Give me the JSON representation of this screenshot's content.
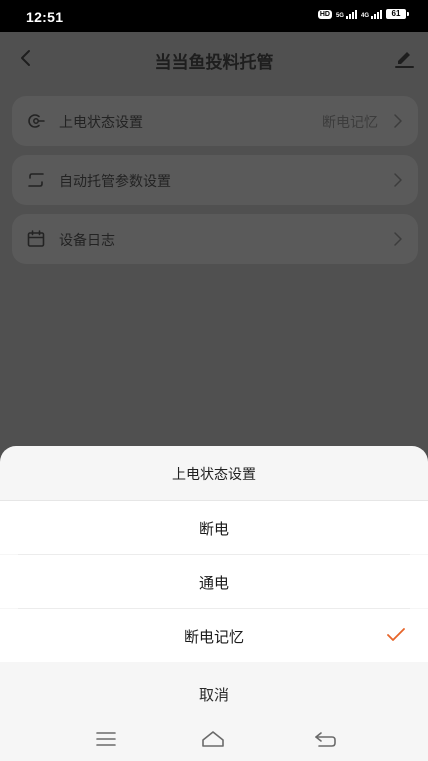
{
  "status_bar": {
    "time": "12:51",
    "hd_badge": "HD",
    "signal_1_label": "5G",
    "signal_2_label": "4G",
    "battery": "61"
  },
  "header": {
    "title": "当当鱼投料托管",
    "back_icon": "chevron-left-icon",
    "edit_icon": "pen-icon"
  },
  "settings": {
    "items": [
      {
        "label": "上电状态设置",
        "value": "断电记忆",
        "icon": "power-plug-icon"
      },
      {
        "label": "自动托管参数设置",
        "value": "",
        "icon": "cycle-icon"
      },
      {
        "label": "设备日志",
        "value": "",
        "icon": "calendar-icon"
      }
    ]
  },
  "sheet": {
    "title": "上电状态设置",
    "options": [
      {
        "label": "断电",
        "selected": false
      },
      {
        "label": "通电",
        "selected": false
      },
      {
        "label": "断电记忆",
        "selected": true
      }
    ],
    "cancel_label": "取消",
    "check_color": "#e7652a"
  },
  "nav": {
    "items": [
      "menu-icon",
      "home-icon",
      "back-icon"
    ]
  }
}
